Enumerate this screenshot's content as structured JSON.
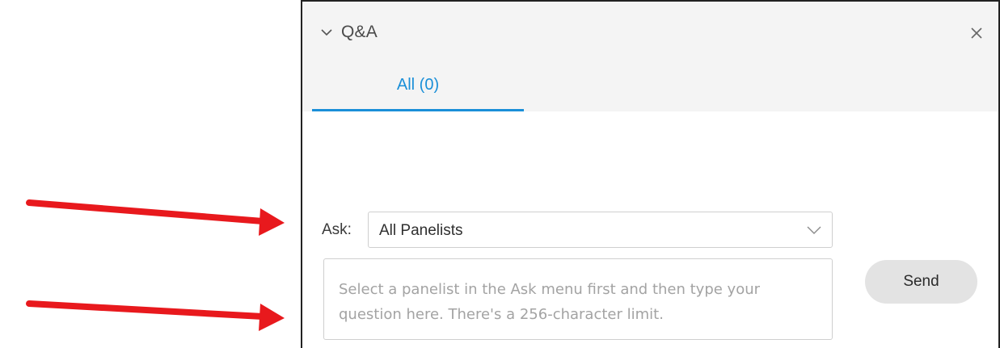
{
  "panel": {
    "title": "Q&A",
    "tabs": [
      {
        "label": "All (0)",
        "active": true
      }
    ]
  },
  "ask": {
    "label": "Ask:",
    "selected": "All Panelists"
  },
  "question": {
    "value": "",
    "placeholder": "Select a panelist in the Ask menu first and then type your question here. There's a 256-character limit."
  },
  "send": {
    "label": "Send"
  },
  "colors": {
    "accent": "#1a8fd8",
    "annotation_arrow": "#e8191d",
    "header_bg": "#f4f4f4",
    "button_bg": "#e3e3e3"
  },
  "icons": {
    "collapse": "chevron-down-icon",
    "close": "close-icon",
    "dropdown": "chevron-down-icon",
    "annotations": "arrow-right-icon"
  }
}
